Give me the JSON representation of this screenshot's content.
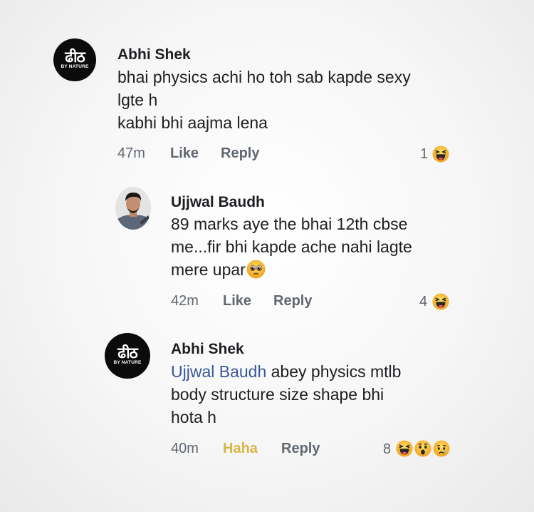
{
  "comments": [
    {
      "author": "Abhi Shek",
      "avatar": {
        "kind": "logo",
        "main": "ढीठ",
        "sub": "BY NATURE"
      },
      "lines": [
        "bhai physics achi ho toh sab kapde sexy",
        "lgte h",
        "kabhi bhi aajma lena"
      ],
      "time": "47m",
      "like": "Like",
      "reply": "Reply",
      "reaction_count": "1",
      "reactions": [
        "haha-emoji"
      ]
    },
    {
      "author": "Ujjwal Baudh",
      "avatar": {
        "kind": "photo"
      },
      "lines": [
        "89 marks aye the bhai 12th cbse",
        "me...fir bhi kapde ache nahi lagte",
        "mere upar"
      ],
      "inline_emoji": "pleading-emoji",
      "time": "42m",
      "like": "Like",
      "reply": "Reply",
      "reaction_count": "4",
      "reactions": [
        "haha-emoji"
      ]
    },
    {
      "author": "Abhi Shek",
      "avatar": {
        "kind": "logo",
        "main": "ढीठ",
        "sub": "BY NATURE"
      },
      "mention": "Ujjwal Baudh",
      "lines": [
        " abey physics mtlb",
        "body structure size shape bhi",
        "hota h"
      ],
      "time": "40m",
      "like": "Haha",
      "reply": "Reply",
      "reaction_count": "8",
      "reactions": [
        "haha-emoji",
        "wow-emoji",
        "sad-emoji"
      ]
    }
  ],
  "colors": {
    "mention": "#385898",
    "haha_active": "#d7b545",
    "meta_grey": "#606770",
    "reaction_yellow": "#f7b125"
  }
}
